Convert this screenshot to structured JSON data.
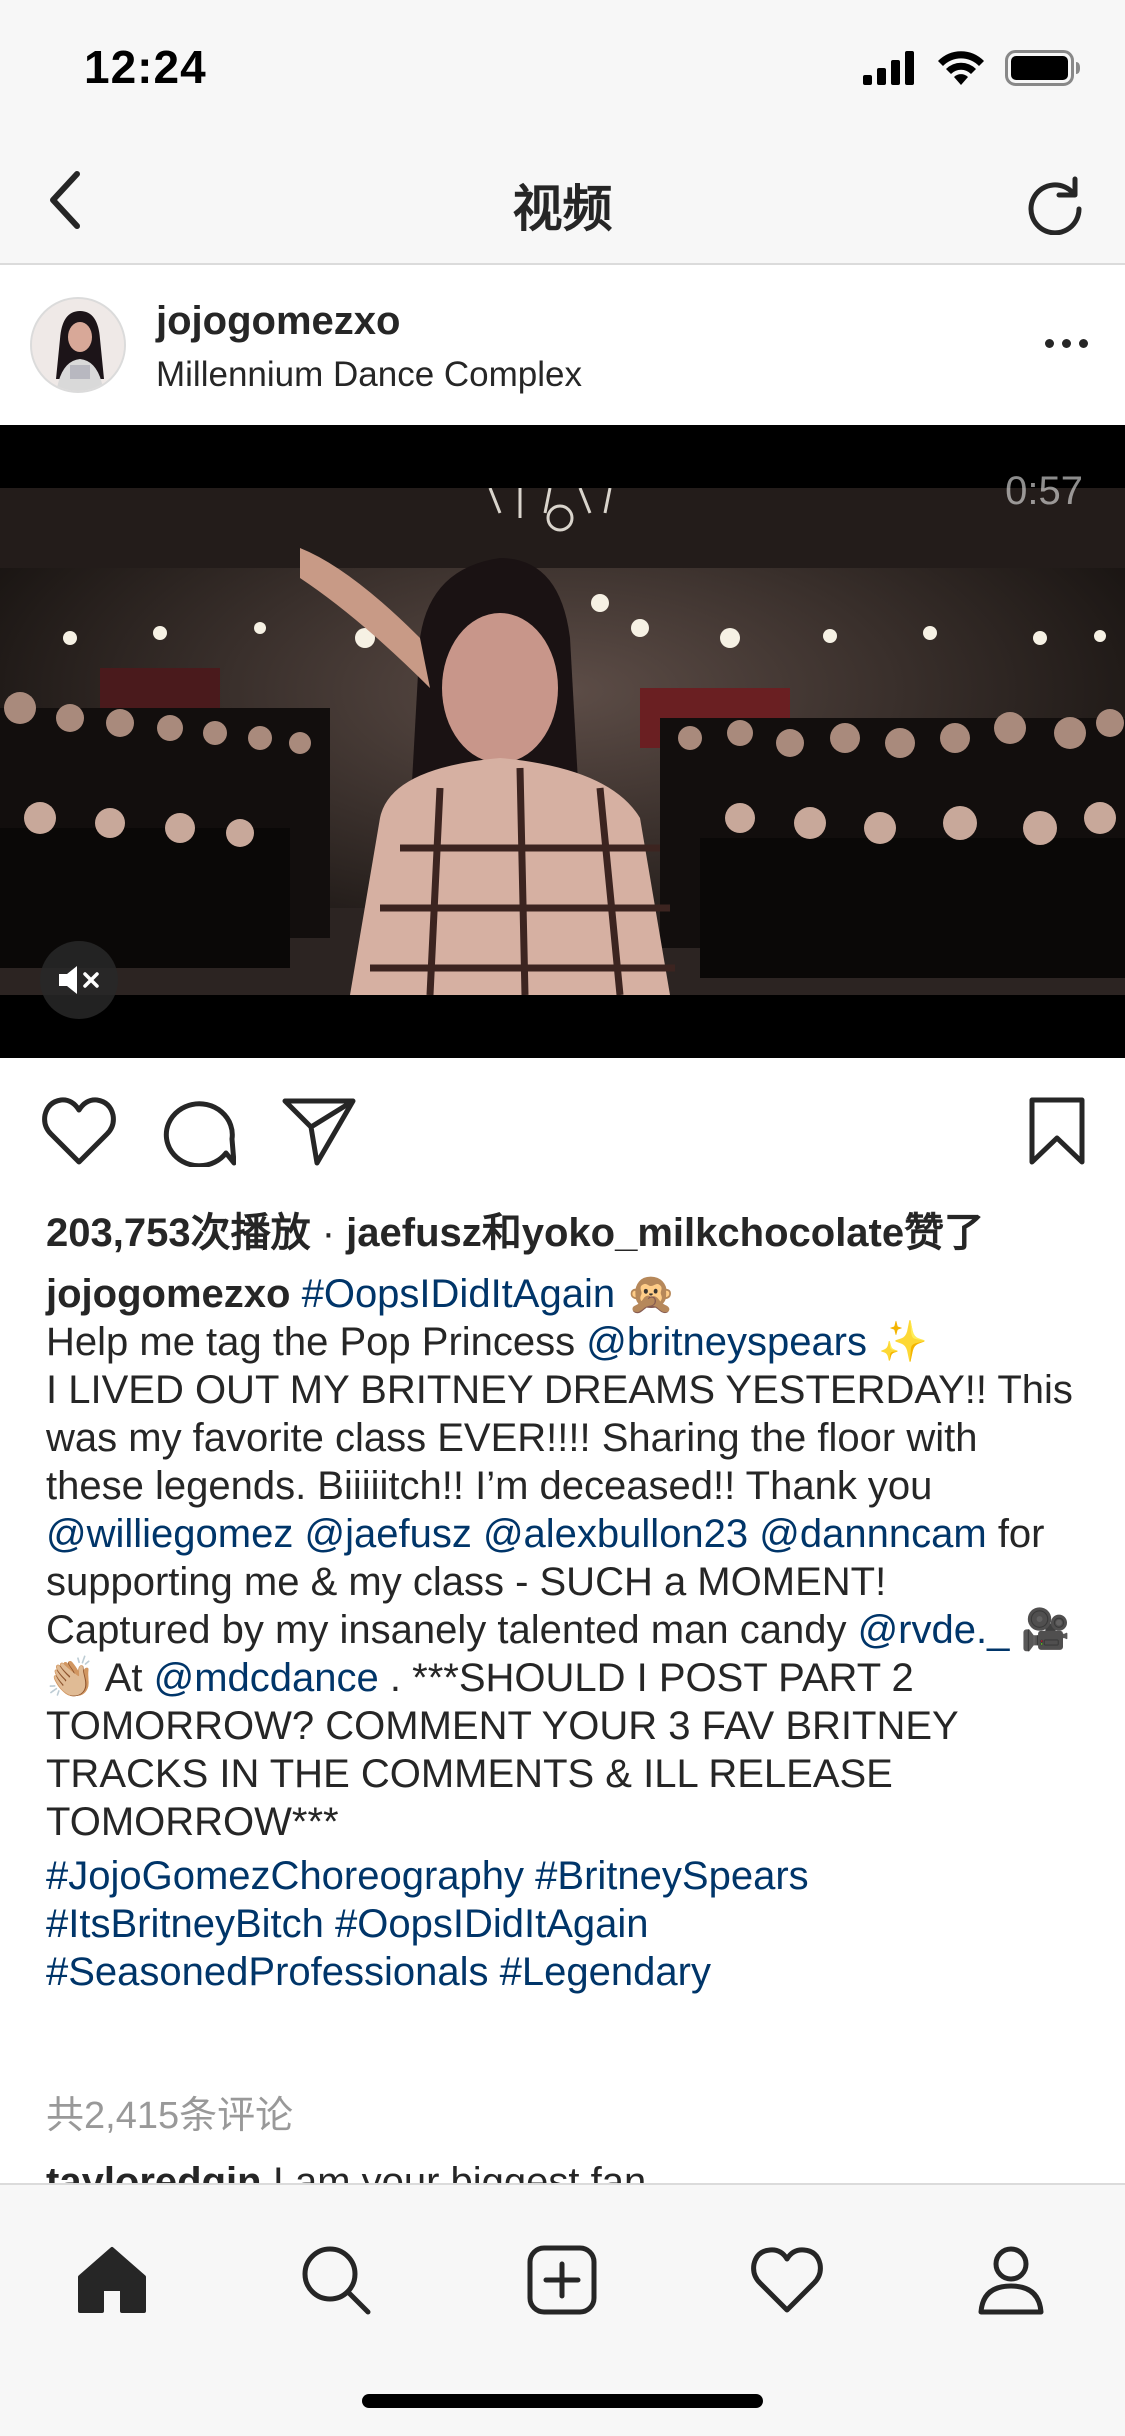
{
  "status_bar": {
    "time": "12:24"
  },
  "nav": {
    "title": "视频"
  },
  "post": {
    "username": "jojogomezxo",
    "location": "Millennium Dance Complex",
    "video": {
      "duration": "0:57",
      "muted": true
    },
    "stats": {
      "views_text": "203,753次播放",
      "separator": " · ",
      "liked_by_user1": "jaefusz",
      "and_text": "和",
      "liked_by_user2": "yoko_milkchocolate",
      "liked_suffix": "赞了"
    },
    "caption": {
      "author": "jojogomezxo",
      "tag_title": "#OopsIDidItAgain",
      "emoji_monkey": "🙊",
      "line2_text": "Help me tag the Pop Princess ",
      "mention_britney": "@britneyspears",
      "emoji_sparkles": "✨",
      "para1": "I LIVED OUT MY BRITNEY DREAMS YESTERDAY!! This was my favorite class EVER!!!! Sharing the floor with these legends. Biiiiitch!! I’m deceased!! Thank you ",
      "mention_willie": "@williegomez",
      "mention_jaefusz": "@jaefusz",
      "mention_alex": "@alexbullon23",
      "mention_dannn": "@dannncam",
      "para1_end": " for supporting me & my class -  SUCH a MOMENT!",
      "para2_start": "Captured by my insanely talented man candy ",
      "mention_rvde": "@rvde._",
      "emoji_camera": "🎥👏🏼",
      "para2_at": " At ",
      "mention_mdc": "@mdcdance",
      "para2_end": " . ***SHOULD I POST PART 2 TOMORROW? COMMENT YOUR 3 FAV BRITNEY TRACKS IN THE COMMENTS & ILL RELEASE TOMORROW***",
      "hashtags": [
        "#JojoGomezChoreography",
        "#BritneySpears",
        "#ItsBritneyBitch",
        "#OopsIDidItAgain",
        "#SeasonedProfessionals",
        "#Legendary"
      ]
    },
    "comments_link": "共2,415条评论",
    "partial_comment": {
      "user": "tayloredgin",
      "text": "I am your biggest fan"
    }
  },
  "tab_bar": {
    "items": [
      "home-icon",
      "search-icon",
      "add-post-icon",
      "activity-heart-icon",
      "profile-icon"
    ]
  }
}
